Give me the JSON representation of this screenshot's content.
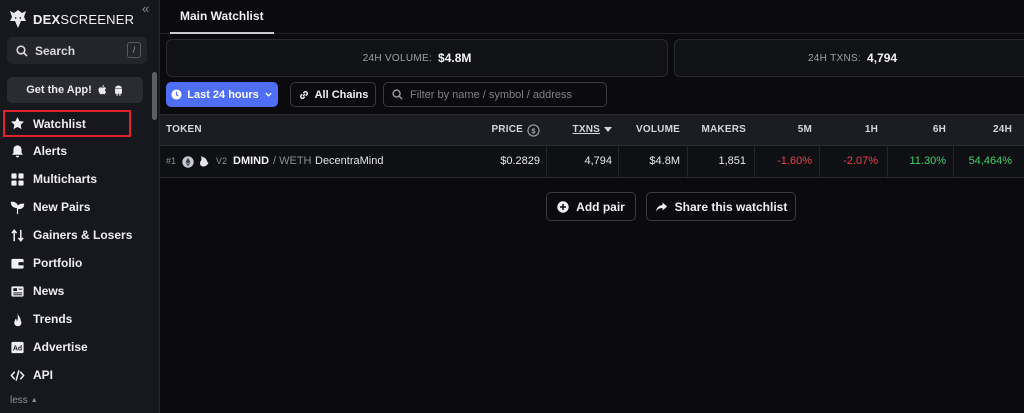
{
  "app": {
    "logo_a": "DEX",
    "logo_b": "SCREENER"
  },
  "sidebar": {
    "search_label": "Search",
    "search_shortcut": "/",
    "get_app_label": "Get the App!",
    "items": [
      {
        "label": "Watchlist",
        "icon": "star-icon"
      },
      {
        "label": "Alerts",
        "icon": "bell-icon"
      },
      {
        "label": "Multicharts",
        "icon": "grid-icon"
      },
      {
        "label": "New Pairs",
        "icon": "sprout-icon"
      },
      {
        "label": "Gainers & Losers",
        "icon": "arrows-updown-icon"
      },
      {
        "label": "Portfolio",
        "icon": "wallet-icon"
      },
      {
        "label": "News",
        "icon": "newspaper-icon"
      },
      {
        "label": "Trends",
        "icon": "flame-icon"
      },
      {
        "label": "Advertise",
        "icon": "ad-icon"
      },
      {
        "label": "API",
        "icon": "code-icon"
      }
    ],
    "less_label": "less"
  },
  "header": {
    "tab_label": "Main Watchlist"
  },
  "stats": {
    "volume_label": "24H VOLUME:",
    "volume_value": "$4.8M",
    "txns_label": "24H TXNS:",
    "txns_value": "4,794"
  },
  "filters": {
    "time_label": "Last 24 hours",
    "chains_label": "All Chains",
    "search_placeholder": "Filter by name / symbol / address"
  },
  "table": {
    "headers": {
      "token": "TOKEN",
      "price": "PRICE",
      "txns": "TXNS",
      "volume": "VOLUME",
      "makers": "MAKERS",
      "m5": "5M",
      "h1": "1H",
      "h6": "6H",
      "h24": "24H"
    },
    "rows": [
      {
        "rank": "#1",
        "version": "V2",
        "symbol": "DMIND",
        "quote": "/ WETH",
        "name": "DecentraMind",
        "price": "$0.2829",
        "txns": "4,794",
        "volume": "$4.8M",
        "makers": "1,851",
        "m5": "-1.60%",
        "h1": "-2.07%",
        "h6": "11.30%",
        "h24": "54,464%"
      }
    ]
  },
  "buttons": {
    "add_pair": "Add pair",
    "share": "Share this watchlist"
  },
  "colors": {
    "accent": "#4f6ef7",
    "negative": "#e8414c",
    "positive": "#3fcf6e",
    "highlight": "#e0222c"
  }
}
